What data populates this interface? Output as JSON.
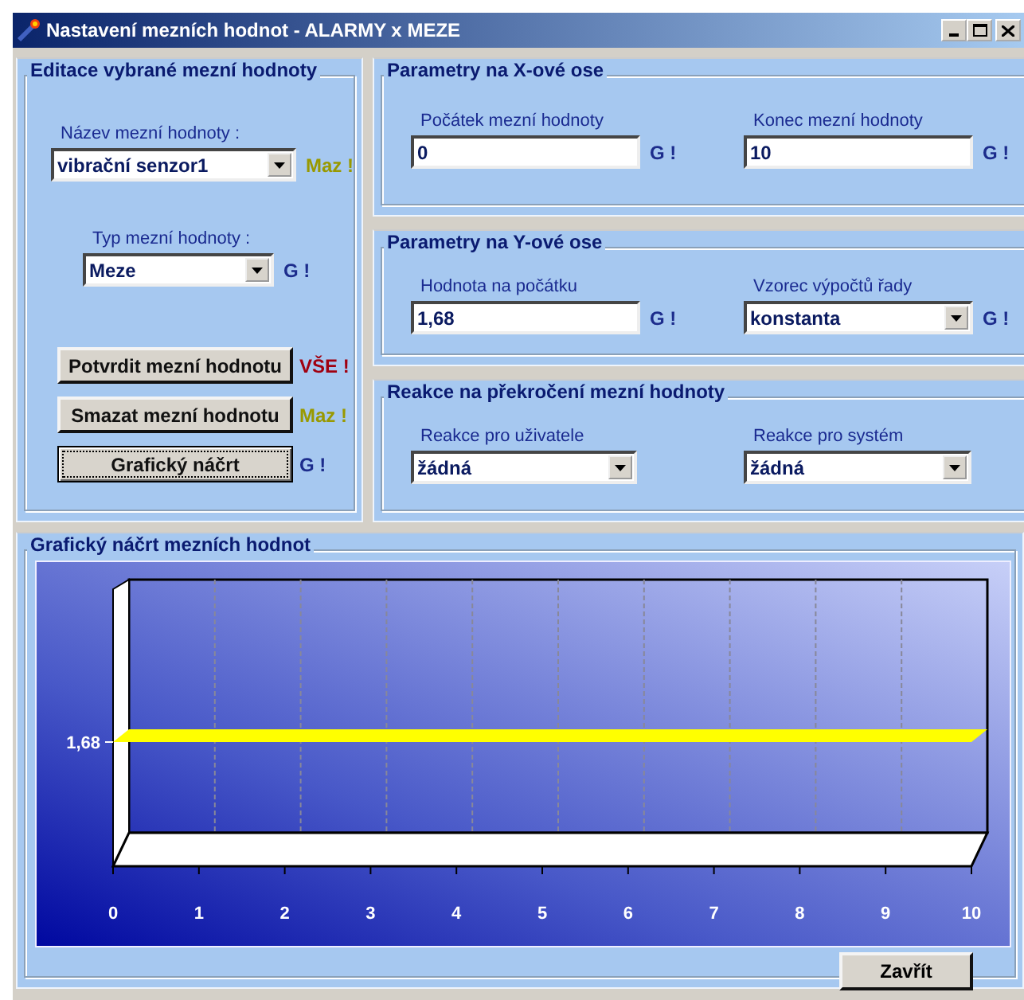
{
  "window": {
    "title": "Nastavení mezních hodnot - ALARMY x MEZE"
  },
  "edit_group": {
    "title": "Editace vybrané mezní hodnoty",
    "fields": [
      {
        "label": "Název mezní hodnoty :",
        "value": "vibrační senzor1",
        "kind": "combo",
        "tag": {
          "text": "Maz !",
          "color": "#999900"
        }
      },
      {
        "label": "Typ mezní hodnoty :",
        "value": "Meze",
        "kind": "combo",
        "tag": {
          "text": "G !",
          "color": "#1c2c8c"
        }
      }
    ],
    "buttons": [
      {
        "label": "Potvrdit mezní hodnotu",
        "focused": false,
        "tag": {
          "text": "VŠE !",
          "color": "#a00010"
        }
      },
      {
        "label": "Smazat mezní hodnotu",
        "focused": false,
        "tag": {
          "text": "Maz !",
          "color": "#999900"
        }
      },
      {
        "label": "Grafický náčrt",
        "focused": true,
        "tag": {
          "text": "G !",
          "color": "#1c2c8c"
        }
      }
    ]
  },
  "x_axis_group": {
    "title": "Parametry na X-ové ose",
    "fields": [
      {
        "label": "Počátek mezní hodnoty",
        "value": "0",
        "kind": "input",
        "tag": {
          "text": "G !",
          "color": "#1c2c8c"
        }
      },
      {
        "label": "Konec mezní hodnoty",
        "value": "10",
        "kind": "input",
        "tag": {
          "text": "G !",
          "color": "#1c2c8c"
        }
      }
    ]
  },
  "y_axis_group": {
    "title": "Parametry na Y-ové ose",
    "fields": [
      {
        "label": "Hodnota na počátku",
        "value": "1,68",
        "kind": "input",
        "tag": {
          "text": "G !",
          "color": "#1c2c8c"
        }
      },
      {
        "label": "Vzorec výpočtů řady",
        "value": "konstanta",
        "kind": "combo",
        "tag": {
          "text": "G !",
          "color": "#1c2c8c"
        }
      }
    ]
  },
  "reaction_group": {
    "title": "Reakce na překročení mezní hodnoty",
    "fields": [
      {
        "label": "Reakce pro uživatele",
        "value": "žádná",
        "kind": "combo"
      },
      {
        "label": "Reakce pro systém",
        "value": "žádná",
        "kind": "combo"
      }
    ]
  },
  "chart_group": {
    "title": "Grafický náčrt mezních hodnot",
    "sketch": {
      "x_axis_labels": [
        "0",
        "1",
        "2",
        "3",
        "4",
        "5",
        "6",
        "7",
        "8",
        "9",
        "10"
      ],
      "limit_label": "1,68"
    }
  },
  "close_button": "Zavřít"
}
